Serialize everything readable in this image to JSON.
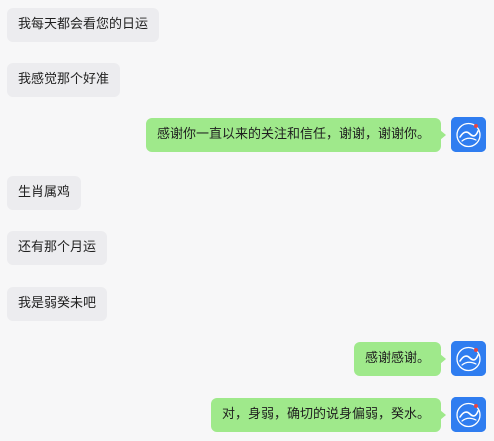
{
  "messages": [
    {
      "side": "incoming",
      "text": "我每天都会看您的日运"
    },
    {
      "side": "incoming",
      "text": "我感觉那个好准"
    },
    {
      "side": "outgoing",
      "text": "感谢你一直以来的关注和信任，谢谢，谢谢你。",
      "avatar": "fortune-brand-avatar"
    },
    {
      "side": "incoming",
      "text": "生肖属鸡"
    },
    {
      "side": "incoming",
      "text": "还有那个月运"
    },
    {
      "side": "incoming",
      "text": "我是弱癸未吧"
    },
    {
      "side": "outgoing",
      "text": "感谢感谢。",
      "avatar": "fortune-brand-avatar"
    },
    {
      "side": "outgoing",
      "text": "对，身弱，确切的说身偏弱，癸水。",
      "avatar": "fortune-brand-avatar"
    }
  ],
  "colors": {
    "background": "#f7f7f8",
    "incoming_bubble": "#ececef",
    "outgoing_bubble": "#9fe98b",
    "avatar": "#2f7df0"
  }
}
